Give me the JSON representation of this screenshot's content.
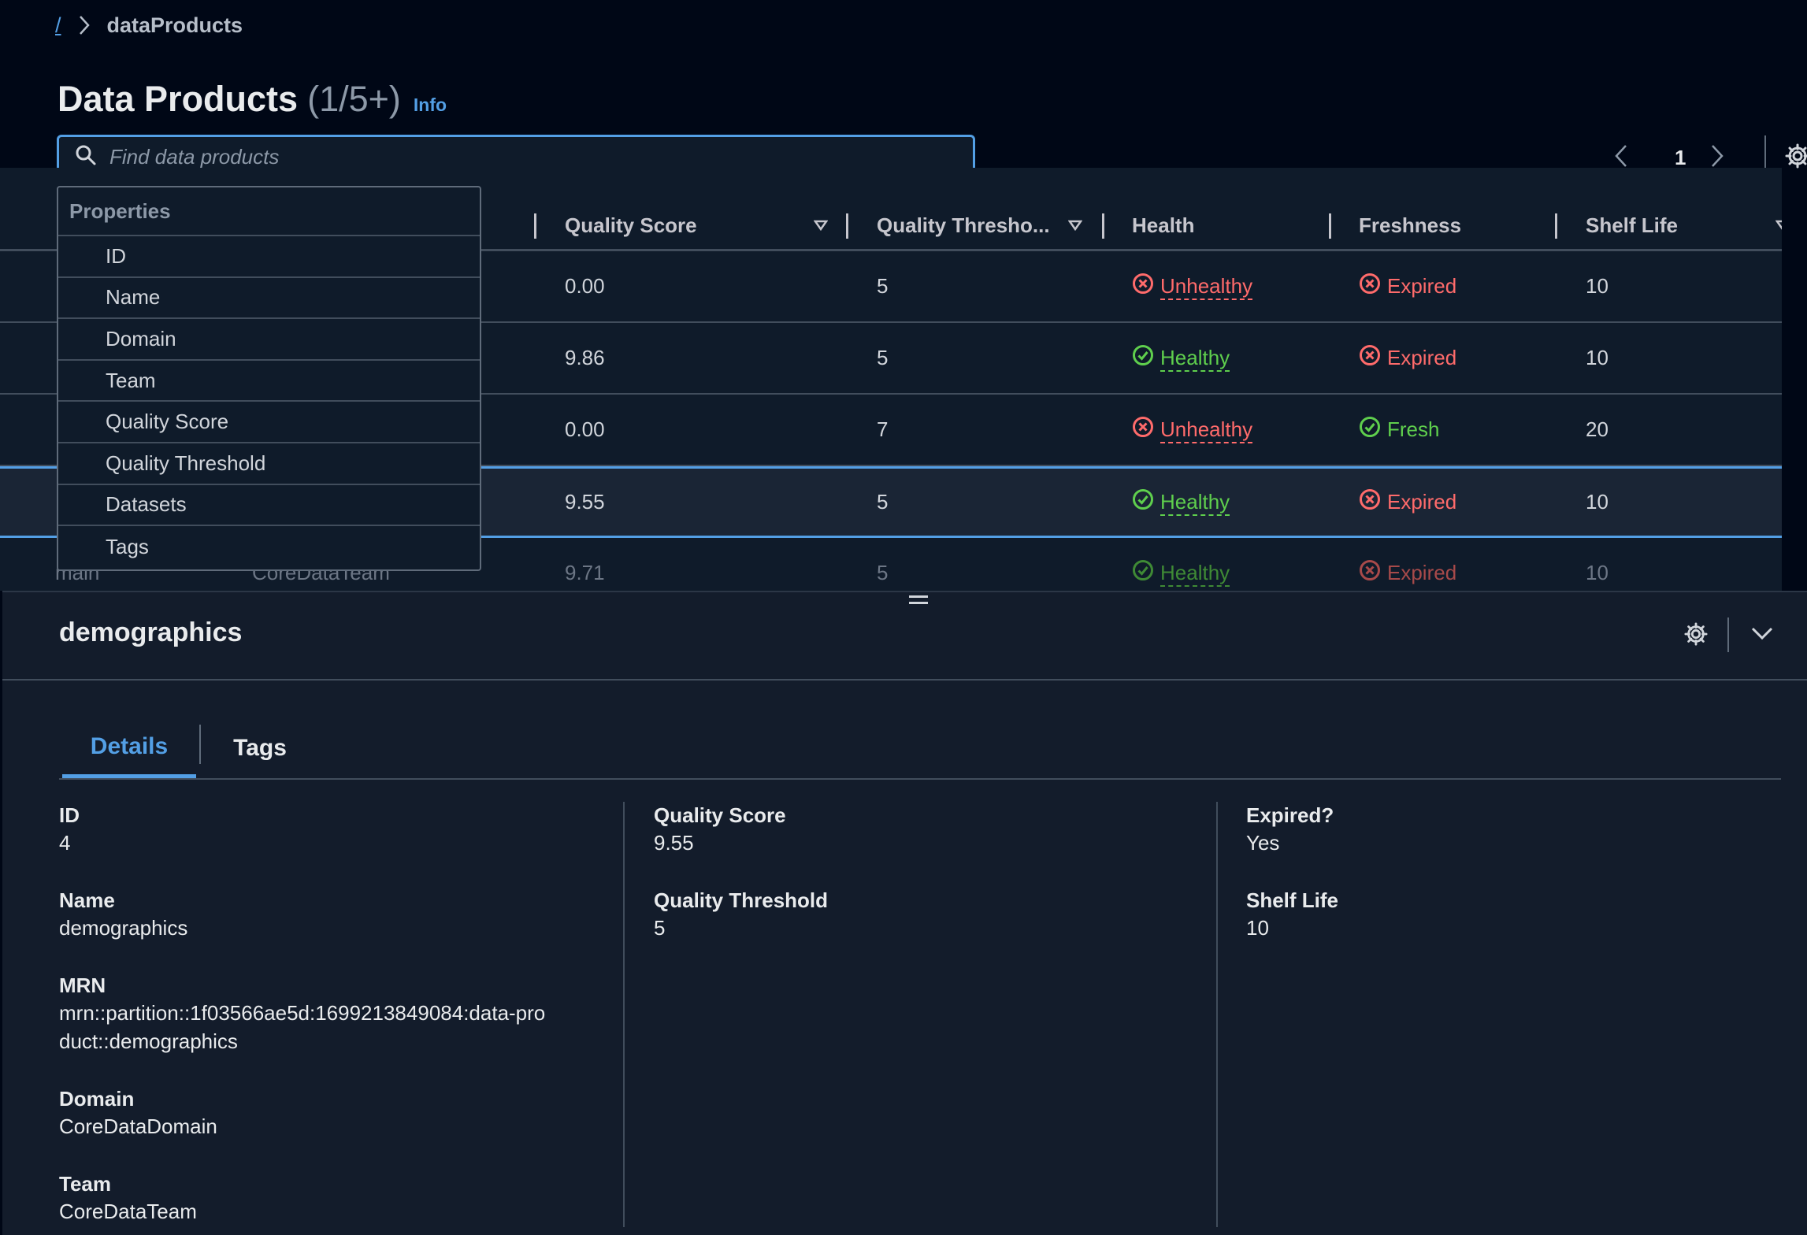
{
  "breadcrumb": {
    "root": "/",
    "current": "dataProducts"
  },
  "header": {
    "title": "Data Products",
    "count": "(1/5+)",
    "info": "Info"
  },
  "search": {
    "placeholder": "Find data products",
    "value": ""
  },
  "pagination": {
    "current_page": "1"
  },
  "table": {
    "columns": [
      "Quality Score",
      "Quality Thresho...",
      "Health",
      "Freshness",
      "Shelf Life"
    ],
    "rows": [
      {
        "quality_score": "0.00",
        "threshold": "5",
        "health": "Unhealthy",
        "freshness": "Expired",
        "shelf_life": "10"
      },
      {
        "quality_score": "9.86",
        "threshold": "5",
        "health": "Healthy",
        "freshness": "Expired",
        "shelf_life": "10"
      },
      {
        "quality_score": "0.00",
        "threshold": "7",
        "health": "Unhealthy",
        "freshness": "Fresh",
        "shelf_life": "20"
      },
      {
        "quality_score": "9.55",
        "threshold": "5",
        "health": "Healthy",
        "freshness": "Expired",
        "shelf_life": "10"
      },
      {
        "domain": "main",
        "team": "CoreDataTeam",
        "quality_score": "9.71",
        "threshold": "5",
        "health": "Healthy",
        "freshness": "Expired",
        "shelf_life": "10"
      }
    ]
  },
  "dropdown": {
    "group_label": "Properties",
    "items": [
      "ID",
      "Name",
      "Domain",
      "Team",
      "Quality Score",
      "Quality Threshold",
      "Datasets",
      "Tags"
    ]
  },
  "panel": {
    "title": "demographics",
    "tabs": [
      "Details",
      "Tags"
    ],
    "col1": [
      {
        "label": "ID",
        "value": "4"
      },
      {
        "label": "Name",
        "value": "demographics"
      },
      {
        "label": "MRN",
        "value": "mrn::partition::1f03566ae5d:1699213849084:data-product::demographics"
      },
      {
        "label": "Domain",
        "value": "CoreDataDomain"
      },
      {
        "label": "Team",
        "value": "CoreDataTeam"
      }
    ],
    "col2": [
      {
        "label": "Quality Score",
        "value": "9.55"
      },
      {
        "label": "Quality Threshold",
        "value": "5"
      }
    ],
    "col3": [
      {
        "label": "Expired?",
        "value": "Yes"
      },
      {
        "label": "Shelf Life",
        "value": "10"
      }
    ]
  },
  "colors": {
    "accent": "#539fe5",
    "healthy": "#5fcf4d",
    "unhealthy": "#ff6b6b",
    "background": "#000716",
    "panel": "#131c2b"
  },
  "icons": [
    "chevron-right-icon",
    "search-icon",
    "chevron-left-icon",
    "gear-icon",
    "sort-caret-icon",
    "status-error-icon",
    "status-success-icon",
    "chevron-down-icon"
  ]
}
